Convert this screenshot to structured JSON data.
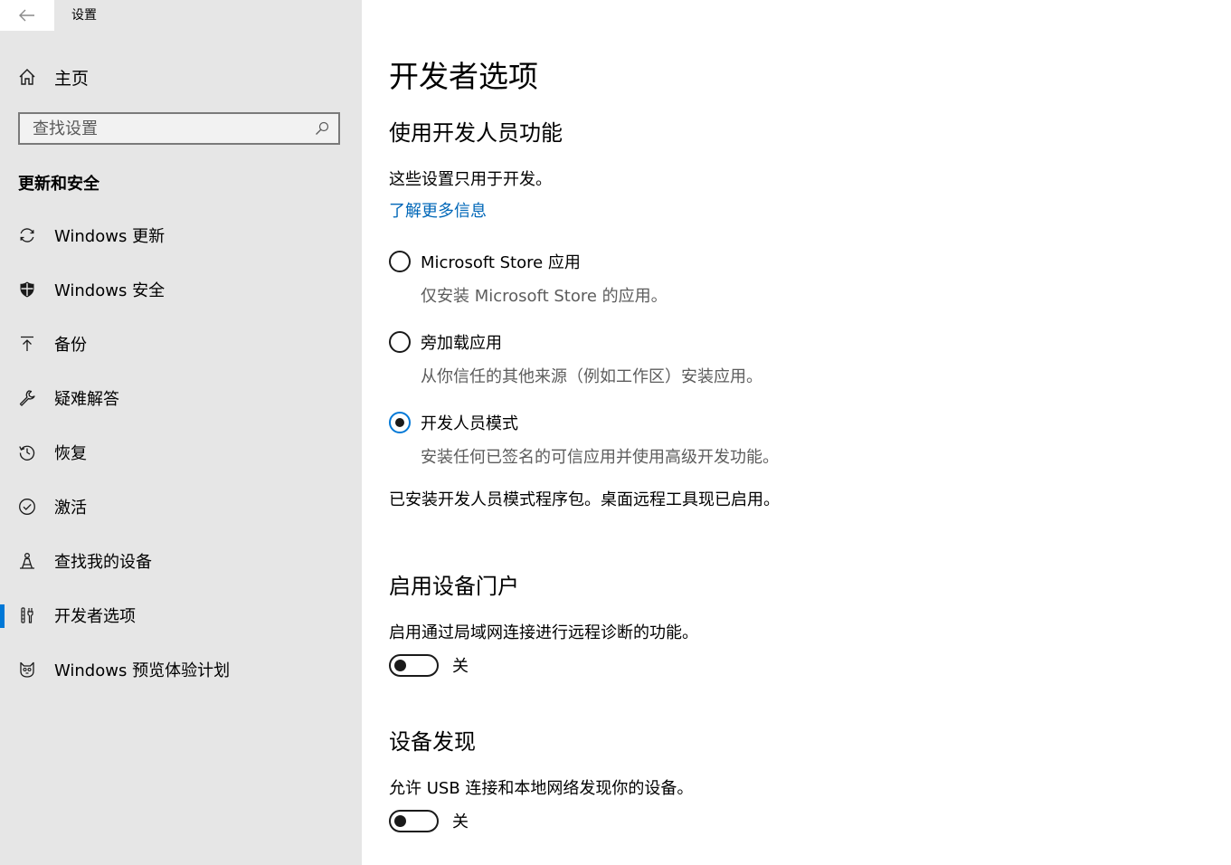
{
  "window": {
    "title": "设置"
  },
  "sidebar": {
    "home_label": "主页",
    "search_placeholder": "查找设置",
    "section_header": "更新和安全",
    "items": [
      {
        "label": "Windows 更新",
        "icon": "refresh-icon"
      },
      {
        "label": "Windows 安全",
        "icon": "shield-icon"
      },
      {
        "label": "备份",
        "icon": "upload-arrow-icon"
      },
      {
        "label": "疑难解答",
        "icon": "wrench-icon"
      },
      {
        "label": "恢复",
        "icon": "history-icon"
      },
      {
        "label": "激活",
        "icon": "check-circle-icon"
      },
      {
        "label": "查找我的设备",
        "icon": "person-locate-icon"
      },
      {
        "label": "开发者选项",
        "icon": "developer-tools-icon",
        "active": true
      },
      {
        "label": "Windows 预览体验计划",
        "icon": "insider-cat-icon"
      }
    ]
  },
  "main": {
    "title": "开发者选项",
    "dev_features": {
      "heading": "使用开发人员功能",
      "intro": "这些设置只用于开发。",
      "learn_more": "了解更多信息",
      "options": [
        {
          "label": "Microsoft Store 应用",
          "description": "仅安装 Microsoft Store 的应用。",
          "checked": false
        },
        {
          "label": "旁加载应用",
          "description": "从你信任的其他来源（例如工作区）安装应用。",
          "checked": false
        },
        {
          "label": "开发人员模式",
          "description": "安装任何已签名的可信应用并使用高级开发功能。",
          "checked": true
        }
      ],
      "status": "已安装开发人员模式程序包。桌面远程工具现已启用。"
    },
    "device_portal": {
      "heading": "启用设备门户",
      "description": "启用通过局域网连接进行远程诊断的功能。",
      "toggle_state": "关"
    },
    "device_discovery": {
      "heading": "设备发现",
      "description": "允许 USB 连接和本地网络发现你的设备。",
      "toggle_state": "关"
    }
  },
  "colors": {
    "accent": "#0078d7",
    "link": "#0067b8",
    "sidebar_bg": "#e6e6e6",
    "secondary_text": "#5c5c5c"
  }
}
